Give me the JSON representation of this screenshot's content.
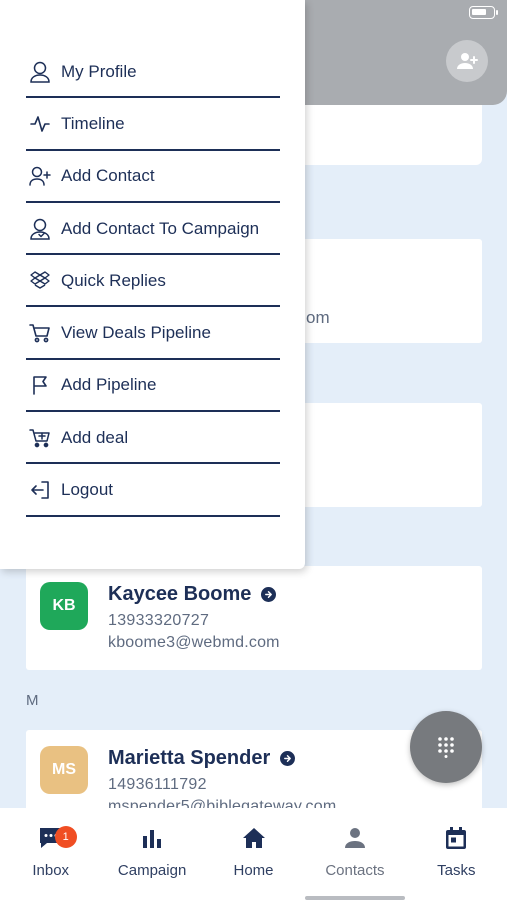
{
  "menu": {
    "items": [
      {
        "label": "My Profile",
        "icon": "user-icon"
      },
      {
        "label": "Timeline",
        "icon": "activity-icon"
      },
      {
        "label": "Add Contact",
        "icon": "user-plus-icon"
      },
      {
        "label": "Add Contact To Campaign",
        "icon": "user-campaign-icon"
      },
      {
        "label": "Quick Replies",
        "icon": "dropbox-icon"
      },
      {
        "label": "View Deals Pipeline",
        "icon": "cart-icon"
      },
      {
        "label": "Add Pipeline",
        "icon": "flag-icon"
      },
      {
        "label": "Add deal",
        "icon": "cart-plus-icon"
      },
      {
        "label": "Logout",
        "icon": "logout-icon"
      }
    ]
  },
  "background": {
    "partial_email_suffix": "om"
  },
  "contacts": [
    {
      "initials": "KB",
      "name": "Kaycee Boome",
      "phone": "13933320727",
      "email": "kboome3@webmd.com",
      "avatar_color": "#1fa85a"
    },
    {
      "initials": "MS",
      "name": "Marietta Spender",
      "phone": "14936111792",
      "email": "mspender5@biblegateway.com",
      "avatar_color": "#e9c182"
    }
  ],
  "section_letter": "M",
  "bottom_nav": {
    "items": [
      {
        "label": "Inbox",
        "icon": "chat-icon",
        "badge": "1"
      },
      {
        "label": "Campaign",
        "icon": "bar-chart-icon"
      },
      {
        "label": "Home",
        "icon": "home-icon"
      },
      {
        "label": "Contacts",
        "icon": "person-icon",
        "active": true
      },
      {
        "label": "Tasks",
        "icon": "calendar-icon"
      }
    ]
  },
  "colors": {
    "primary": "#1d2f57",
    "badge": "#f04e23",
    "background": "#e4eef9"
  }
}
